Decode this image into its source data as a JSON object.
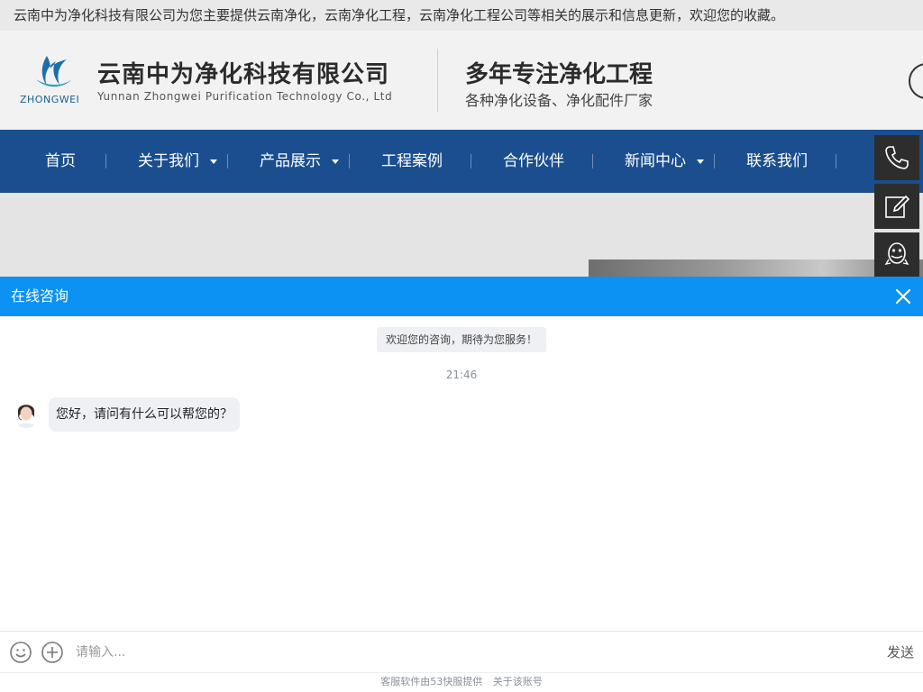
{
  "topbar": {
    "notice": "云南中为净化科技有限公司为您主要提供云南净化，云南净化工程，云南净化工程公司等相关的展示和信息更新，欢迎您的收藏。"
  },
  "header": {
    "logo_text": "ZHONGWEI",
    "company_cn": "云南中为净化科技有限公司",
    "company_en": "Yunnan Zhongwei Purification Technology Co., Ltd",
    "slogan_main": "多年专注净化工程",
    "slogan_sub": "各种净化设备、净化配件厂家"
  },
  "nav": {
    "items": [
      {
        "label": "首页",
        "has_dropdown": false
      },
      {
        "label": "关于我们",
        "has_dropdown": true
      },
      {
        "label": "产品展示",
        "has_dropdown": true
      },
      {
        "label": "工程案例",
        "has_dropdown": false
      },
      {
        "label": "合作伙伴",
        "has_dropdown": false
      },
      {
        "label": "新闻中心",
        "has_dropdown": true
      },
      {
        "label": "联系我们",
        "has_dropdown": false
      }
    ],
    "background": "#1a4e8f"
  },
  "side_buttons": [
    {
      "icon": "phone-icon"
    },
    {
      "icon": "edit-icon"
    },
    {
      "icon": "qq-icon"
    }
  ],
  "chat": {
    "title": "在线咨询",
    "welcome": "欢迎您的咨询，期待为您服务！",
    "timestamp": "21:46",
    "message": "您好，请问有什么可以帮您的？",
    "input_placeholder": "请输入...",
    "send_label": "发送",
    "footer_provider": "客服软件由53快服提供",
    "footer_about": "关于该账号",
    "accent_color": "#0b92f2"
  }
}
